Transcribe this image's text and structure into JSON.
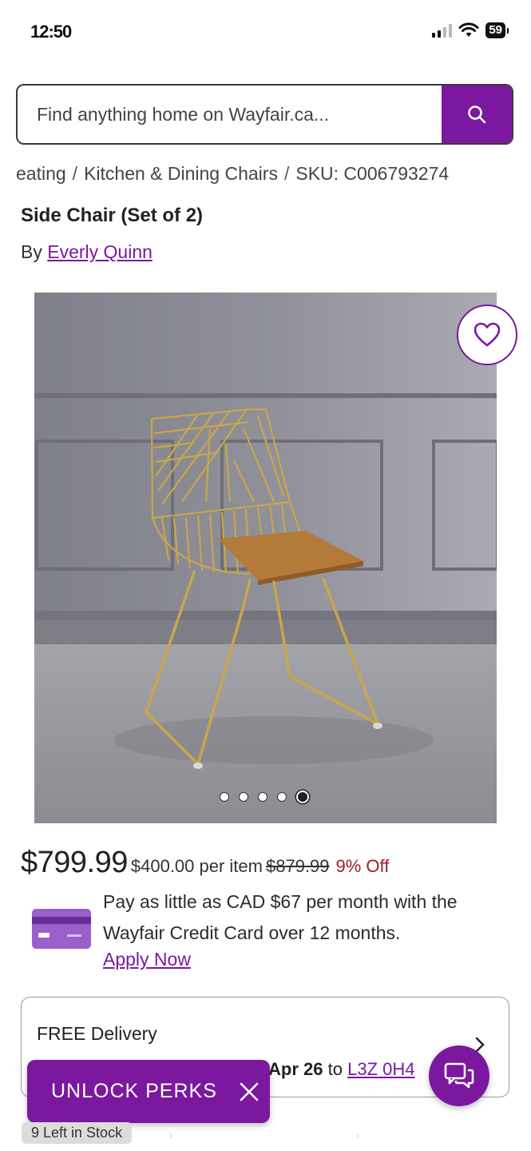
{
  "status_bar": {
    "time": "12:50",
    "battery": "59"
  },
  "search": {
    "placeholder": "Find anything home on Wayfair.ca..."
  },
  "breadcrumb": {
    "items": [
      "eating",
      "Kitchen & Dining Chairs"
    ],
    "sku": "SKU: C006793274"
  },
  "product": {
    "title": "Side Chair (Set of 2)",
    "by_prefix": "By",
    "brand": "Everly Quinn",
    "image_count": 5,
    "active_image": 5
  },
  "pricing": {
    "price": "$799.99",
    "per_item": "$400.00 per item",
    "was": "$879.99",
    "discount": "9% Off"
  },
  "financing": {
    "text": "Pay as little as CAD $67 per month with the Wayfair Credit Card over 12 months.",
    "apply_label": "Apply Now"
  },
  "delivery": {
    "label": "FREE Delivery",
    "date": "Apr 26",
    "to": "to",
    "zip": "L3Z 0H4"
  },
  "perks": {
    "label": "UNLOCK PERKS"
  },
  "stock": {
    "label": "9 Left in Stock"
  },
  "colors": {
    "brand_purple": "#7b189f",
    "discount_red": "#9b1b30"
  }
}
